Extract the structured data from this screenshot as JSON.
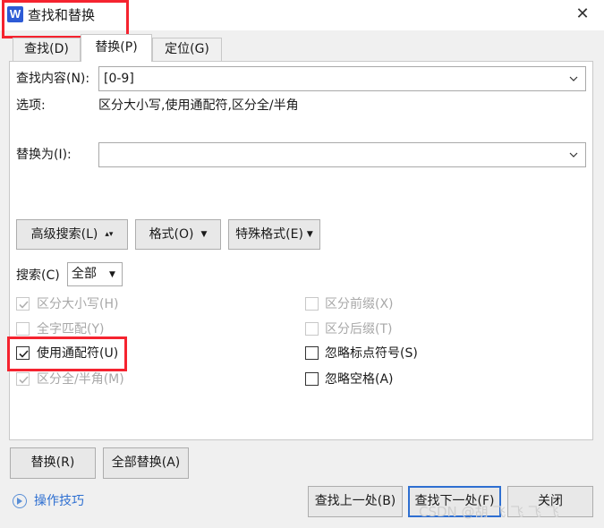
{
  "window": {
    "title": "查找和替换",
    "app_icon": "W"
  },
  "tabs": [
    {
      "label": "查找(D)"
    },
    {
      "label": "替换(P)"
    },
    {
      "label": "定位(G)"
    }
  ],
  "find": {
    "label": "查找内容(N):",
    "value": "[0-9]"
  },
  "options": {
    "label": "选项:",
    "value": "区分大小写,使用通配符,区分全/半角"
  },
  "replace": {
    "label": "替换为(I):",
    "value": ""
  },
  "buttons": {
    "advanced": "高级搜索(L)",
    "format": "格式(O)",
    "special": "特殊格式(E)",
    "replace": "替换(R)",
    "replace_all": "全部替换(A)",
    "find_prev": "查找上一处(B)",
    "find_next": "查找下一处(F)",
    "close": "关闭"
  },
  "search": {
    "label": "搜索(C)",
    "selected": "全部"
  },
  "checkboxes_left": [
    {
      "label": "区分大小写(H)",
      "checked": true,
      "enabled": false
    },
    {
      "label": "全字匹配(Y)",
      "checked": false,
      "enabled": false
    },
    {
      "label": "使用通配符(U)",
      "checked": true,
      "enabled": true
    },
    {
      "label": "区分全/半角(M)",
      "checked": true,
      "enabled": false
    }
  ],
  "checkboxes_right": [
    {
      "label": "区分前缀(X)",
      "checked": false,
      "enabled": false
    },
    {
      "label": "区分后缀(T)",
      "checked": false,
      "enabled": false
    },
    {
      "label": "忽略标点符号(S)",
      "checked": false,
      "enabled": true
    },
    {
      "label": "忽略空格(A)",
      "checked": false,
      "enabled": true
    }
  ],
  "help": {
    "label": "操作技巧"
  },
  "watermark": "CSDN @胡 飞 飞 飞 飞",
  "colors": {
    "highlight_box": "#f5232f",
    "link": "#2e6fd1",
    "app_icon_bg": "#2d5bd6"
  }
}
